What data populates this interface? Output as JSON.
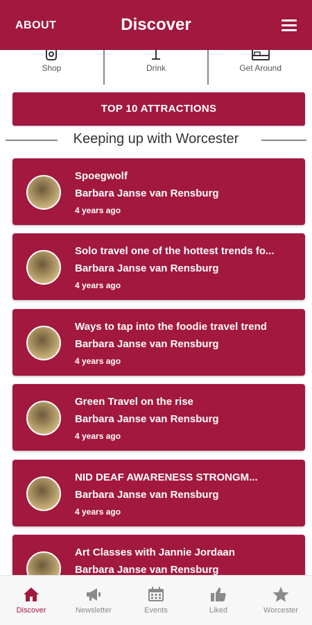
{
  "header": {
    "about_label": "ABOUT",
    "title": "Discover",
    "menu_icon": "hamburger-menu-icon"
  },
  "categories": [
    {
      "label": "Shop",
      "icon": "shop-icon"
    },
    {
      "label": "Drink",
      "icon": "drink-icon"
    },
    {
      "label": "Get Around",
      "icon": "bed-icon"
    }
  ],
  "top10_label": "TOP 10 ATTRACTIONS",
  "section_title": "Keeping up with Worcester",
  "posts": [
    {
      "title": "Spoegwolf",
      "author": "Barbara Janse van Rensburg",
      "date": "4 years ago"
    },
    {
      "title": "Solo travel one of the hottest trends fo...",
      "author": "Barbara Janse van Rensburg",
      "date": "4 years ago"
    },
    {
      "title": "Ways to tap into the foodie travel trend",
      "author": "Barbara Janse van Rensburg",
      "date": "4 years ago"
    },
    {
      "title": "Green Travel on the rise",
      "author": "Barbara Janse van Rensburg",
      "date": "4 years ago"
    },
    {
      "title": "NID DEAF AWARENESS STRONGM...",
      "author": "Barbara Janse van Rensburg",
      "date": "4 years ago"
    },
    {
      "title": "Art Classes with Jannie Jordaan",
      "author": "Barbara Janse van Rensburg",
      "date": ""
    }
  ],
  "tabs": [
    {
      "label": "Discover",
      "icon": "home-icon"
    },
    {
      "label": "Newsletter",
      "icon": "megaphone-icon"
    },
    {
      "label": "Events",
      "icon": "calendar-icon"
    },
    {
      "label": "Liked",
      "icon": "thumbs-up-icon"
    },
    {
      "label": "Worcester",
      "icon": "star-icon"
    }
  ],
  "colors": {
    "brand": "#a2183f",
    "tab_inactive": "#8a8a8a",
    "background": "#ffffff"
  }
}
